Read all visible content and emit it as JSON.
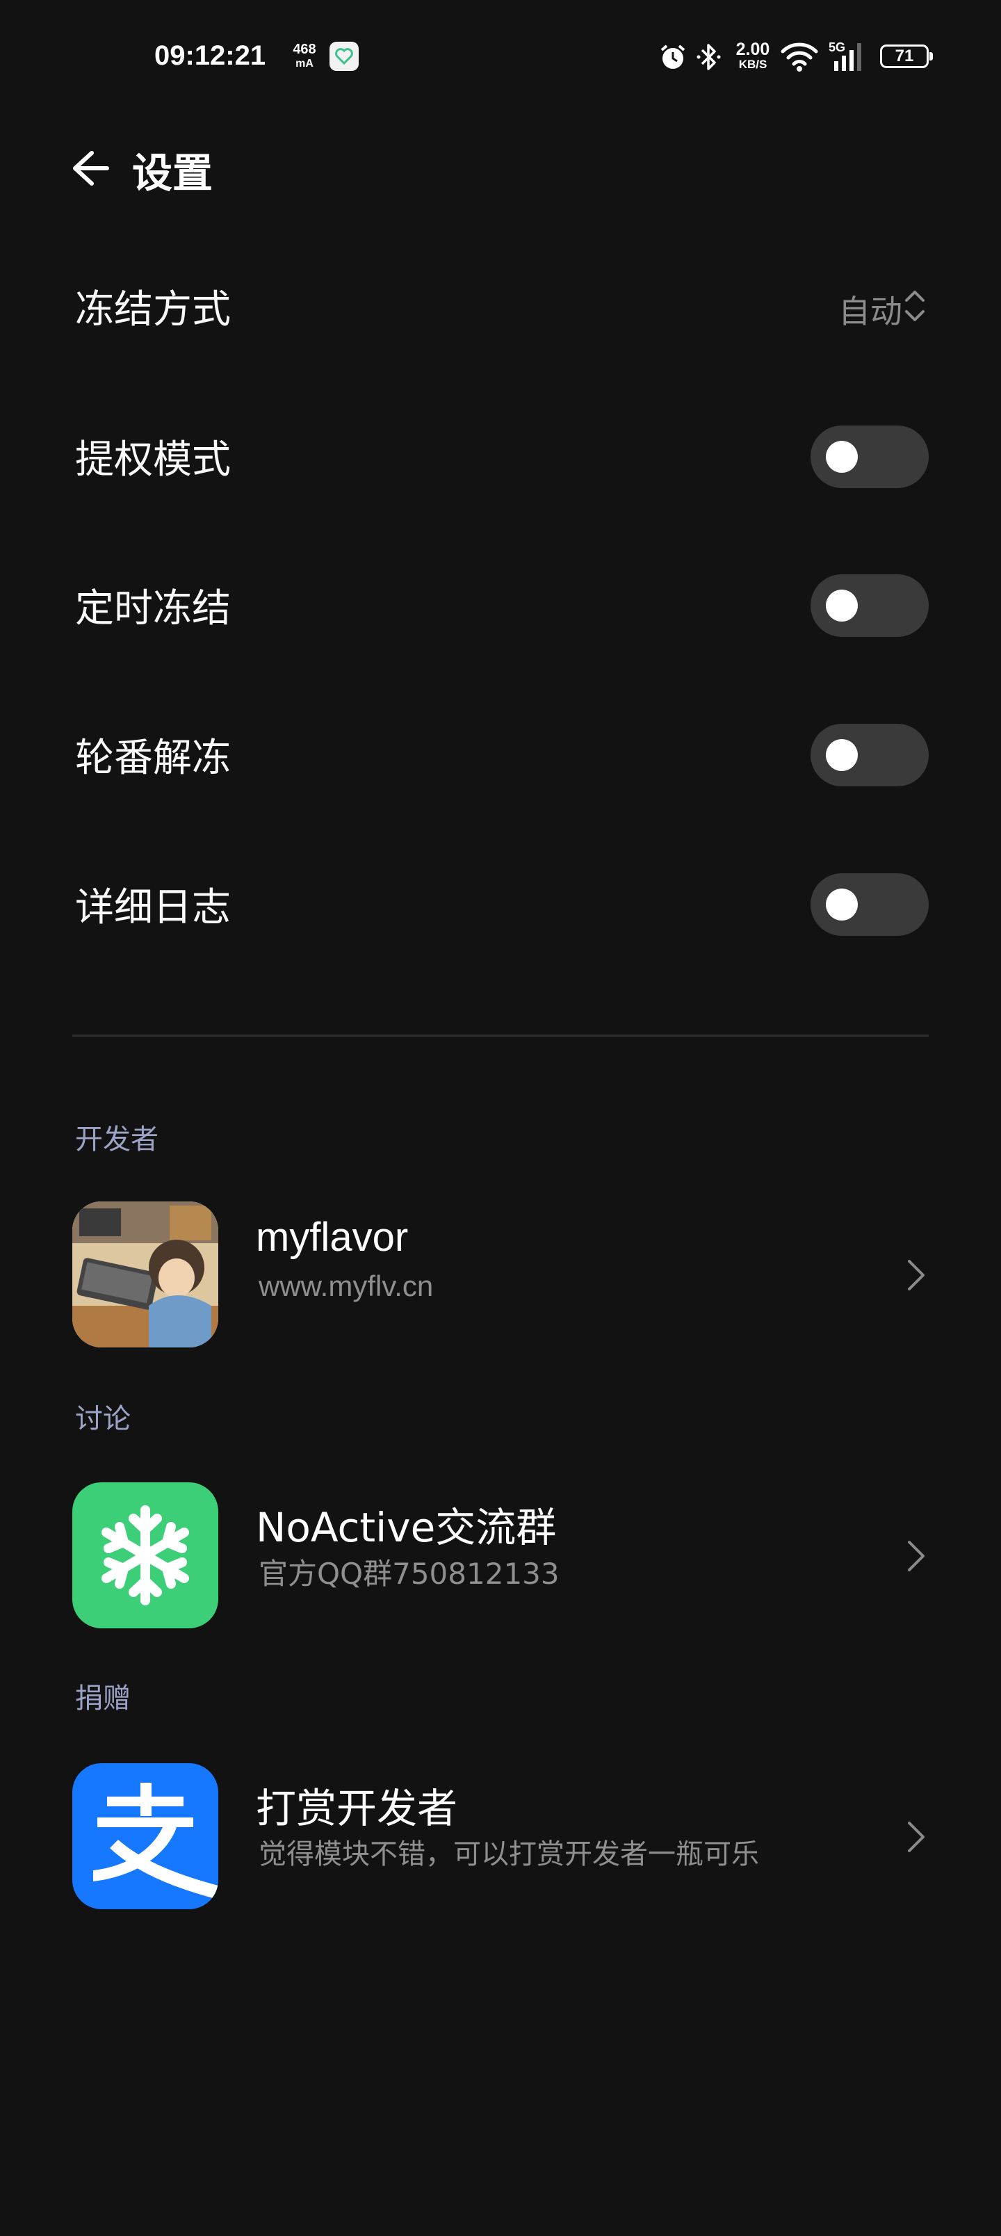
{
  "status_bar": {
    "time": "09:12:21",
    "current_top": "468",
    "current_unit": "mA",
    "net_speed": "2.00",
    "net_unit": "KB/S",
    "network_type": "5G",
    "battery": "71",
    "icons": [
      "heart-app-icon",
      "alarm-icon",
      "bluetooth-icon",
      "wifi-icon",
      "signal-icon",
      "battery-icon"
    ]
  },
  "header": {
    "title": "设置"
  },
  "settings": {
    "freeze_mode": {
      "label": "冻结方式",
      "value": "自动"
    },
    "privilege_mode": {
      "label": "提权模式",
      "enabled": false
    },
    "timed_freeze": {
      "label": "定时冻结",
      "enabled": false
    },
    "rotate_unfreeze": {
      "label": "轮番解冻",
      "enabled": false
    },
    "verbose_log": {
      "label": "详细日志",
      "enabled": false
    }
  },
  "sections": {
    "developer": {
      "header": "开发者",
      "title": "myflavor",
      "subtitle": "www.myflv.cn"
    },
    "discussion": {
      "header": "讨论",
      "title": "NoActive交流群",
      "subtitle": "官方QQ群750812133",
      "icon_color": "#3ccf77"
    },
    "donate": {
      "header": "捐赠",
      "title": "打赏开发者",
      "subtitle": "觉得模块不错，可以打赏开发者一瓶可乐",
      "icon_color": "#1677ff"
    }
  }
}
